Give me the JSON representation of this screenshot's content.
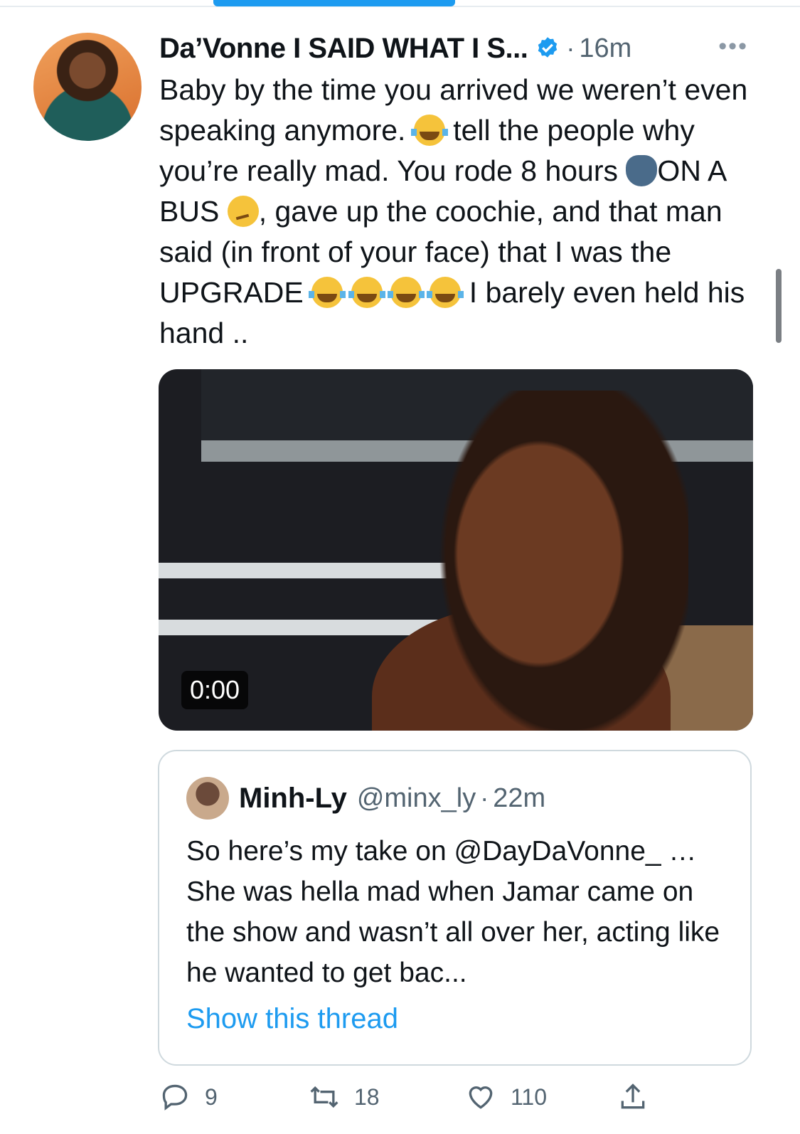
{
  "tweet": {
    "display_name": "Da’Vonne I SAID WHAT I S...",
    "sep": "·",
    "time": "16m",
    "more": "•••",
    "text_1": "Baby by the time you arrived we weren’t even speaking anymore.",
    "text_2": "tell the people why you’re really mad. You rode 8 hours",
    "text_3": "ON A BUS",
    "text_4": ", gave up the coochie, and that man said (in front of your face) that I was the UPGRADE",
    "text_5": "I barely even held his hand ..",
    "video_time": "0:00"
  },
  "quoted": {
    "name": "Minh-Ly",
    "handle": "@minx_ly",
    "sep": "·",
    "time": "22m",
    "text": "So here’s my take on @DayDaVonne_ … She was hella mad when Jamar came on the show and wasn’t all over her, acting like he wanted to get bac...",
    "show_thread": "Show this thread"
  },
  "actions": {
    "replies": "9",
    "retweets": "18",
    "likes": "110"
  },
  "icons": [
    "verified-badge-icon",
    "laughing-emoji-icon",
    "speaking-head-emoji-icon",
    "woozy-emoji-icon",
    "reply-icon",
    "retweet-icon",
    "like-icon",
    "share-icon"
  ],
  "colors": {
    "accent": "#1d9bf0",
    "secondary_text": "#536471",
    "text": "#0f1419"
  }
}
